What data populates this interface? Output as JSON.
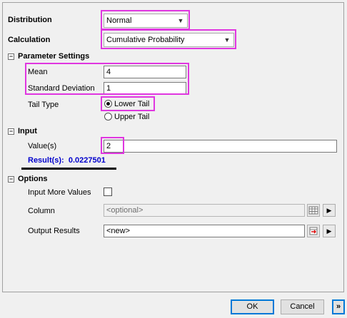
{
  "distribution": {
    "label": "Distribution",
    "value": "Normal"
  },
  "calculation": {
    "label": "Calculation",
    "value": "Cumulative Probability"
  },
  "parameter_settings": {
    "header": "Parameter Settings",
    "toggle": "−",
    "mean": {
      "label": "Mean",
      "value": "4"
    },
    "std_dev": {
      "label": "Standard Deviation",
      "value": "1"
    },
    "tail_type": {
      "label": "Tail Type",
      "options": [
        "Lower Tail",
        "Upper Tail"
      ],
      "selected": "Lower Tail"
    }
  },
  "input": {
    "header": "Input",
    "toggle": "−",
    "values_label": "Value(s)",
    "values_value": "2",
    "result_text": "Result(s):  0.0227501"
  },
  "options": {
    "header": "Options",
    "toggle": "−",
    "input_more_values_label": "Input More Values",
    "input_more_values_checked": false,
    "column": {
      "label": "Column",
      "placeholder": "<optional>"
    },
    "output_results": {
      "label": "Output Results",
      "value": "<new>"
    }
  },
  "footer": {
    "ok_label": "OK",
    "cancel_label": "Cancel",
    "expand_label": "»"
  },
  "colors": {
    "highlight": "#e036e0",
    "result": "#0000cc"
  }
}
